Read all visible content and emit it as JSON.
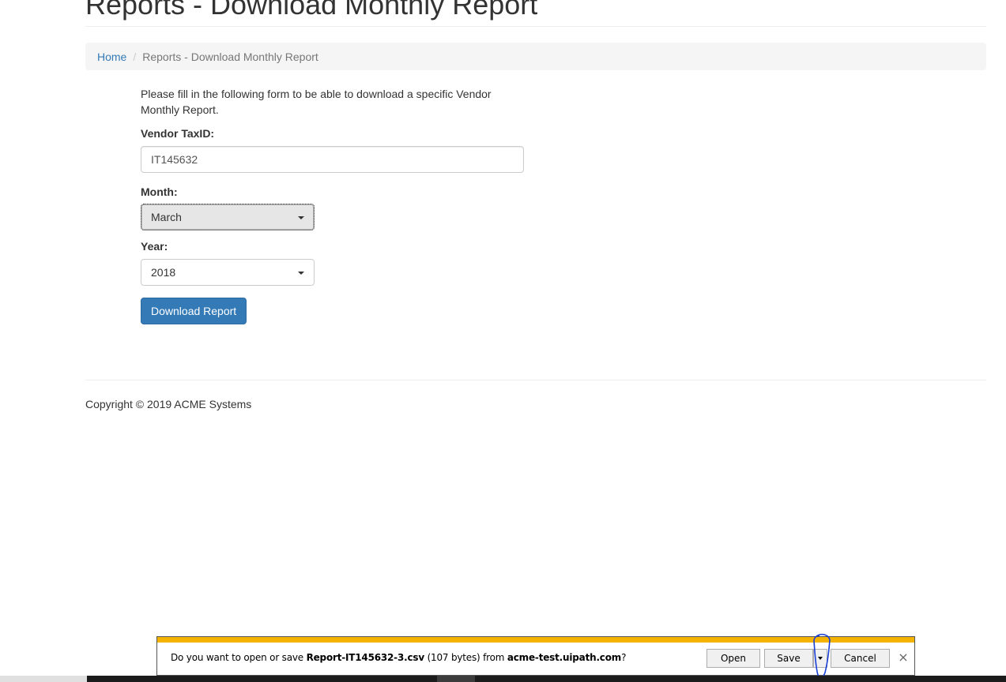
{
  "page": {
    "title": "Reports - Download Monthly Report"
  },
  "breadcrumb": {
    "home": "Home",
    "separator": "/",
    "current": "Reports - Download Monthly Report"
  },
  "form": {
    "intro": "Please fill in the following form to be able to download a specific Vendor Monthly Report.",
    "vendor_label": "Vendor TaxID:",
    "vendor_value": "IT145632",
    "month_label": "Month:",
    "month_value": "March",
    "year_label": "Year:",
    "year_value": "2018",
    "download_label": "Download Report"
  },
  "footer": {
    "copyright": "Copyright © 2019 ACME Systems"
  },
  "download_bar": {
    "prefix": "Do you want to open or save ",
    "filename": "Report-IT145632-3.csv",
    "size": " (107 bytes) from ",
    "domain": "acme-test.uipath.com",
    "suffix": "?",
    "open_label": "Open",
    "save_label": "Save",
    "cancel_label": "Cancel",
    "close_glyph": "×",
    "accent_color": "#f4b300"
  },
  "colors": {
    "primary": "#337ab7",
    "breadcrumb_bg": "#f5f5f5"
  }
}
